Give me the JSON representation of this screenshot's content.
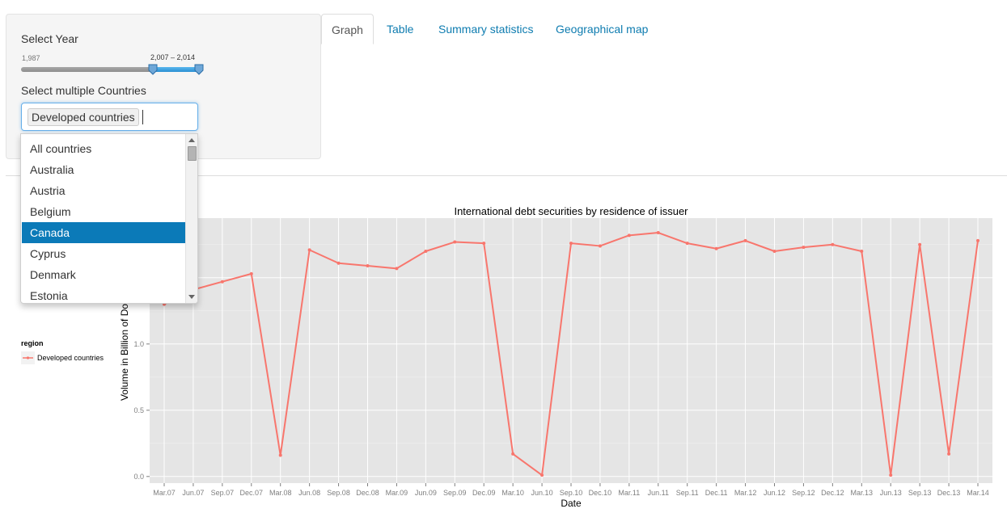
{
  "sidebar": {
    "year_label": "Select Year",
    "slider": {
      "min": 1987,
      "min_label": "1,987",
      "max": 2014,
      "from": 2007,
      "to": 2014,
      "range_label": "2,007 – 2,014"
    },
    "countries_label": "Select multiple Countries",
    "selected_chip": "Developed countries",
    "dropdown": {
      "items": [
        "All countries",
        "Australia",
        "Austria",
        "Belgium",
        "Canada",
        "Cyprus",
        "Denmark",
        "Estonia"
      ],
      "highlighted": "Canada"
    }
  },
  "tabs": [
    {
      "label": "Graph",
      "active": true
    },
    {
      "label": "Table",
      "active": false
    },
    {
      "label": "Summary statistics",
      "active": false
    },
    {
      "label": "Geographical map",
      "active": false
    }
  ],
  "colors": {
    "line": "#f8766d",
    "panel_bg": "#e5e5e5",
    "link": "#0e7cb0",
    "highlight": "#0b7ab8"
  },
  "chart_data": {
    "type": "line",
    "title": "International debt securities by residence of issuer",
    "xlabel": "Date",
    "ylabel": "Volume in Billion of Dolla",
    "x": [
      "Mar.07",
      "Jun.07",
      "Sep.07",
      "Dec.07",
      "Mar.08",
      "Jun.08",
      "Sep.08",
      "Dec.08",
      "Mar.09",
      "Jun.09",
      "Sep.09",
      "Dec.09",
      "Mar.10",
      "Jun.10",
      "Sep.10",
      "Dec.10",
      "Mar.11",
      "Jun.11",
      "Sep.11",
      "Dec.11",
      "Mar.12",
      "Jun.12",
      "Sep.12",
      "Dec.12",
      "Mar.13",
      "Jun.13",
      "Sep.13",
      "Dec.13",
      "Mar.14"
    ],
    "series": [
      {
        "name": "Developed countries",
        "values": [
          1.3,
          1.41,
          1.47,
          1.53,
          0.16,
          1.71,
          1.61,
          1.59,
          1.57,
          1.7,
          1.77,
          1.76,
          0.17,
          0.01,
          1.76,
          1.74,
          1.82,
          1.84,
          1.76,
          1.72,
          1.78,
          1.7,
          1.73,
          1.75,
          1.7,
          0.01,
          1.75,
          0.17,
          1.78
        ]
      }
    ],
    "y_ticks": [
      "0.0",
      "0.5",
      "1.0"
    ],
    "y_tick_values": [
      0.0,
      0.5,
      1.0
    ],
    "ylim": [
      -0.05,
      1.95
    ],
    "grid": true,
    "legend": {
      "title": "region",
      "placement": "left",
      "entries": [
        "Developed countries"
      ]
    }
  }
}
